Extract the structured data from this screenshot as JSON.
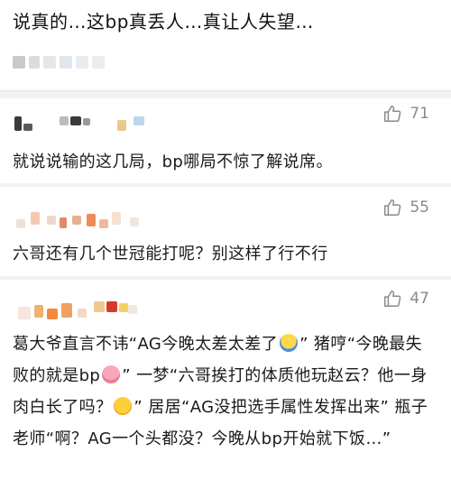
{
  "post": {
    "text": "说真的…这bp真丢人…真让人失望…"
  },
  "comments": [
    {
      "likes": "71",
      "text": "就说说输的这几局，bp哪局不惊了解说席。"
    },
    {
      "likes": "55",
      "text": "六哥还有几个世冠能打呢？别这样了行不行"
    },
    {
      "likes": "47",
      "text_parts": [
        "葛大爷直言不讳“AG今晚太差太差了",
        "” 猪哼“今晚最失败的就是bp",
        "” 一梦“六哥挨打的体质他玩赵云？他一身肉白长了吗？",
        "” 居居“AG没把选手属性发挥出来” 瓶子老师“啊？AG一个头都没？今晚从bp开始就下饭…”"
      ],
      "emoji_icons": [
        "shrug-emoji-icon",
        "pig-emoji-icon",
        "thinking-emoji-icon"
      ]
    }
  ],
  "colors": {
    "background": "#f2f2f2",
    "card": "#ffffff",
    "like_gray": "#8a8a8a"
  }
}
